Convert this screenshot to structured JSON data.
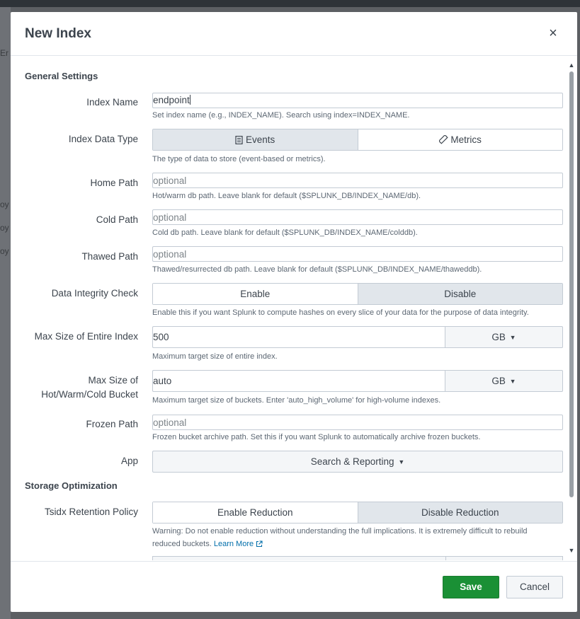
{
  "dialog": {
    "title": "New Index",
    "close_label": "×"
  },
  "sections": {
    "general": "General Settings",
    "storage": "Storage Optimization"
  },
  "fields": {
    "index_name": {
      "label": "Index Name",
      "value": "endpoint",
      "help": "Set index name (e.g., INDEX_NAME). Search using index=INDEX_NAME."
    },
    "data_type": {
      "label": "Index Data Type",
      "options": [
        "Events",
        "Metrics"
      ],
      "selected": "Events",
      "help": "The type of data to store (event-based or metrics)."
    },
    "home_path": {
      "label": "Home Path",
      "placeholder": "optional",
      "help": "Hot/warm db path. Leave blank for default ($SPLUNK_DB/INDEX_NAME/db)."
    },
    "cold_path": {
      "label": "Cold Path",
      "placeholder": "optional",
      "help": "Cold db path. Leave blank for default ($SPLUNK_DB/INDEX_NAME/colddb)."
    },
    "thawed_path": {
      "label": "Thawed Path",
      "placeholder": "optional",
      "help": "Thawed/resurrected db path. Leave blank for default ($SPLUNK_DB/INDEX_NAME/thaweddb)."
    },
    "integrity": {
      "label": "Data Integrity Check",
      "options": [
        "Enable",
        "Disable"
      ],
      "selected": "Disable",
      "help": "Enable this if you want Splunk to compute hashes on every slice of your data for the purpose of data integrity."
    },
    "max_index": {
      "label": "Max Size of Entire Index",
      "value": "500",
      "unit": "GB",
      "help": "Maximum target size of entire index."
    },
    "max_bucket": {
      "label_line1": "Max Size of",
      "label_line2": "Hot/Warm/Cold Bucket",
      "value": "auto",
      "unit": "GB",
      "help": "Maximum target size of buckets. Enter 'auto_high_volume' for high-volume indexes."
    },
    "frozen_path": {
      "label": "Frozen Path",
      "placeholder": "optional",
      "help": "Frozen bucket archive path. Set this if you want Splunk to automatically archive frozen buckets."
    },
    "app": {
      "label": "App",
      "value": "Search & Reporting"
    },
    "tsidx": {
      "label": "Tsidx Retention Policy",
      "options": [
        "Enable Reduction",
        "Disable Reduction"
      ],
      "selected": "Disable Reduction",
      "help_line1": "Warning: Do not enable reduction without understanding the full implications. It is extremely difficult to rebuild",
      "help_line2": "reduced buckets.",
      "learn_more": "Learn More"
    }
  },
  "footer": {
    "save": "Save",
    "cancel": "Cancel"
  },
  "background": {
    "fragments": [
      "Er",
      "oy",
      "oy",
      "oy"
    ]
  }
}
